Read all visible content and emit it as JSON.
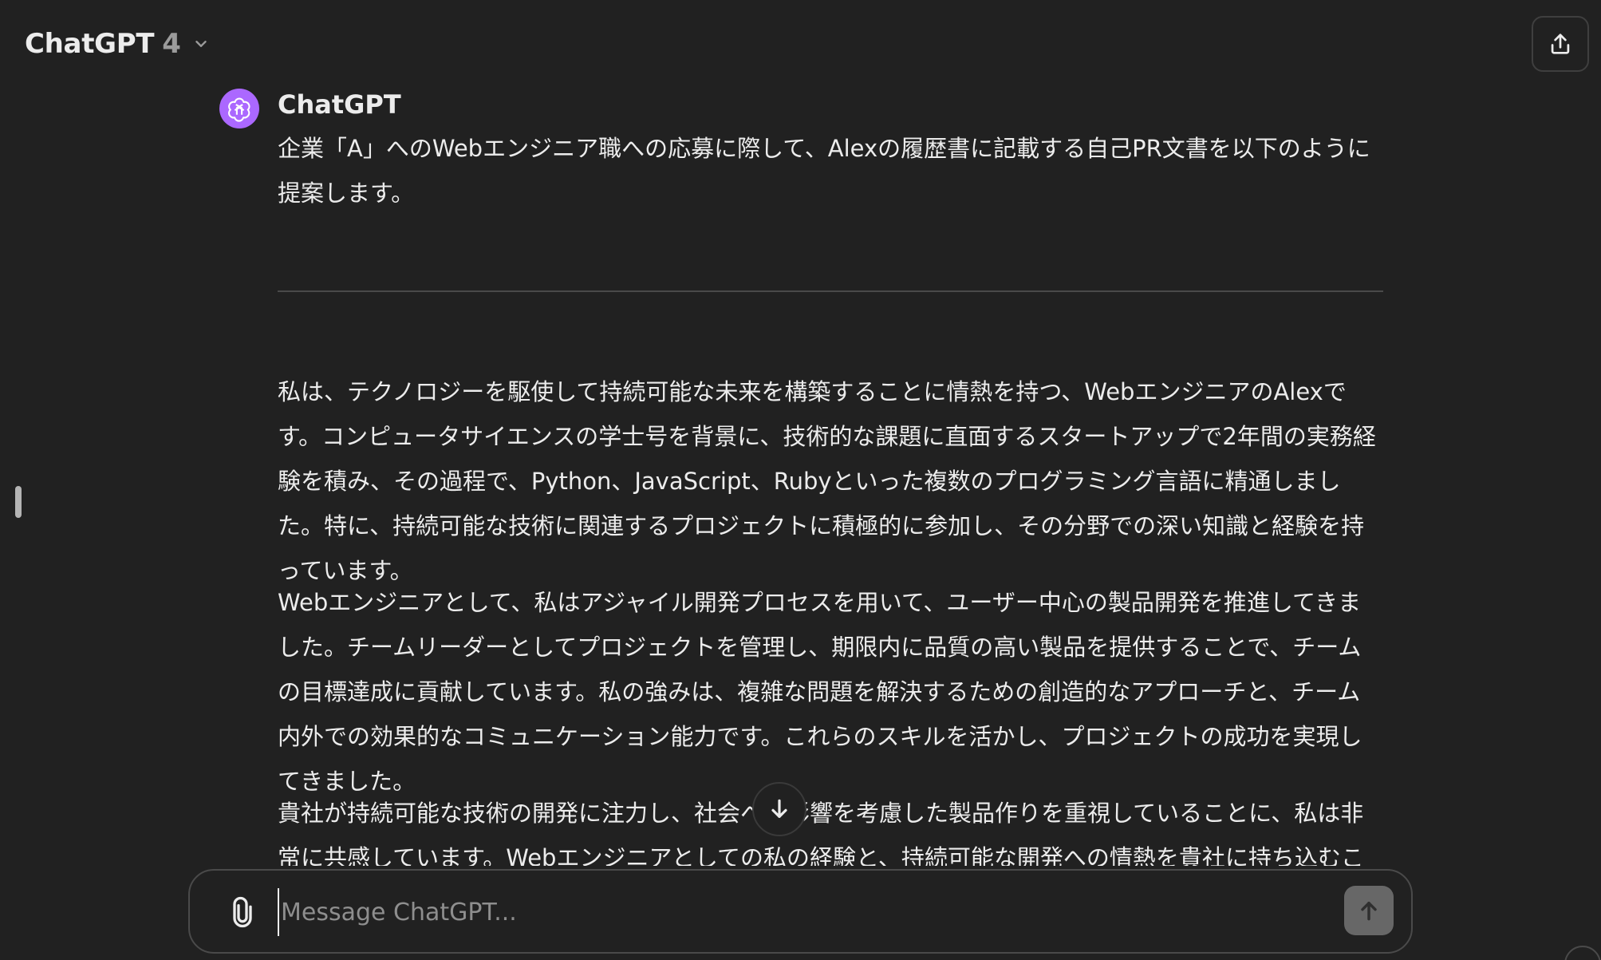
{
  "header": {
    "model_name": "ChatGPT",
    "model_version": "4"
  },
  "message": {
    "author": "ChatGPT",
    "intro": "企業「A」へのWebエンジニア職への応募に際して、Alexの履歴書に記載する自己PR文書を以下のように提案します。",
    "paragraphs": [
      "私は、テクノロジーを駆使して持続可能な未来を構築することに情熱を持つ、WebエンジニアのAlexです。コンピュータサイエンスの学士号を背景に、技術的な課題に直面するスタートアップで2年間の実務経験を積み、その過程で、Python、JavaScript、Rubyといった複数のプログラミング言語に精通しました。特に、持続可能な技術に関連するプロジェクトに積極的に参加し、その分野での深い知識と経験を持っています。",
      "Webエンジニアとして、私はアジャイル開発プロセスを用いて、ユーザー中心の製品開発を推進してきました。チームリーダーとしてプロジェクトを管理し、期限内に品質の高い製品を提供することで、チームの目標達成に貢献しています。私の強みは、複雑な問題を解決するための創造的なアプローチと、チーム内外での効果的なコミュニケーション能力です。これらのスキルを活かし、プロジェクトの成功を実現してきました。",
      "貴社が持続可能な技術の開発に注力し、社会への影響を考慮した製品作りを重視していることに、私は非常に共感しています。Webエンジニアとしての私の経験と、持続可能な開発への情熱を貴社に持ち込むことで、革"
    ]
  },
  "composer": {
    "placeholder": "Message ChatGPT..."
  },
  "colors": {
    "background": "#212121",
    "avatar": "#ab68ff",
    "text": "#ececec",
    "muted": "#9b9b9b",
    "send_button": "#676767"
  },
  "icons": {
    "chevron": "chevron-down-icon",
    "share": "share-icon",
    "avatar": "openai-logo-icon",
    "scroll": "arrow-down-icon",
    "attach": "paperclip-icon",
    "send": "arrow-up-icon"
  }
}
